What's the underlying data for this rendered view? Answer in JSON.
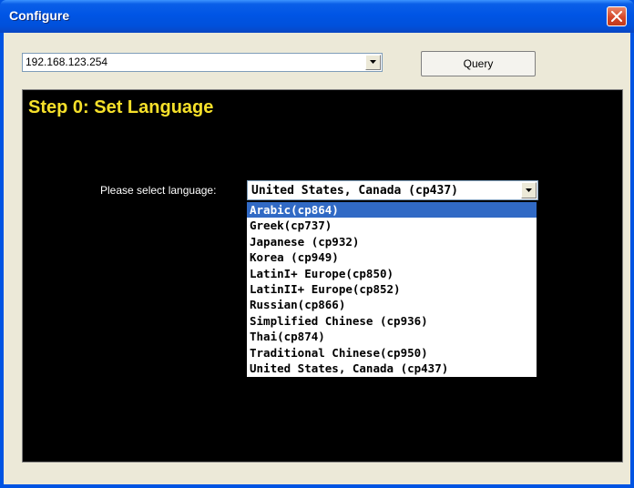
{
  "window": {
    "title": "Configure"
  },
  "toolbar": {
    "ip_combo_value": "192.168.123.254",
    "query_label": "Query"
  },
  "panel": {
    "step_title": "Step 0: Set Language",
    "language_label": "Please select language:",
    "language_selected": "United States, Canada (cp437)",
    "language_options": [
      "Arabic(cp864)",
      "Greek(cp737)",
      "Japanese (cp932)",
      "Korea (cp949)",
      "LatinI+ Europe(cp850)",
      "LatinII+ Europe(cp852)",
      "Russian(cp866)",
      "Simplified Chinese (cp936)",
      "Thai(cp874)",
      "Traditional Chinese(cp950)",
      "United States, Canada (cp437)"
    ],
    "highlighted_option": "Arabic(cp864)"
  },
  "colors": {
    "title_bar": "#0054e3",
    "panel_bg": "#000000",
    "step_title": "#f6e02a",
    "highlight": "#316ac5"
  },
  "icons": [
    "close-icon",
    "dropdown-arrow-icon"
  ]
}
